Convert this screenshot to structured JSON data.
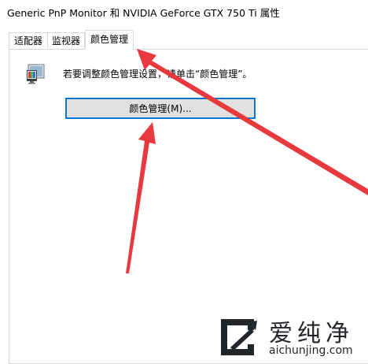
{
  "window": {
    "title": "Generic PnP Monitor 和 NVIDIA GeForce GTX 750 Ti 属性"
  },
  "tabs": [
    {
      "label": "适配器",
      "active": false
    },
    {
      "label": "监视器",
      "active": false
    },
    {
      "label": "颜色管理",
      "active": true
    }
  ],
  "color_management": {
    "icon": "monitor-color-icon",
    "info_text": "若要调整颜色管理设置，请单击“颜色管理”。",
    "button_label": "颜色管理(M)..."
  },
  "annotation": {
    "arrow_color": "#e8393e"
  },
  "watermark": {
    "title": "爱纯净",
    "url": "aichunjing.com"
  },
  "colors": {
    "button_border": "#0078d7",
    "button_bg": "#e1e1e1"
  }
}
